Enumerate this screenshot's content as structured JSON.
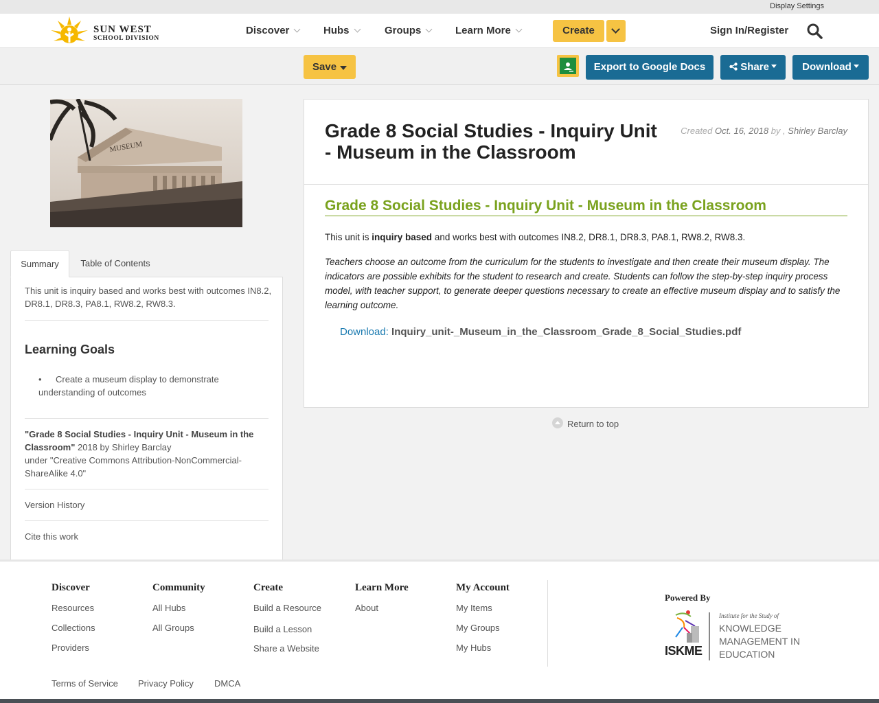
{
  "util": {
    "display_settings": "Display Settings"
  },
  "header": {
    "logo_line1": "SUN WEST",
    "logo_line2": "SCHOOL DIVISION",
    "nav": [
      "Discover",
      "Hubs",
      "Groups",
      "Learn More"
    ],
    "create": "Create",
    "signin": "Sign In/Register"
  },
  "toolbar": {
    "save": "Save",
    "export": "Export to Google Docs",
    "share": "Share",
    "download": "Download"
  },
  "colors": {
    "accent_yellow": "#f6c343",
    "button_blue": "#1a6b94",
    "heading_green": "#7aa21e",
    "link_blue": "#1a7ab0"
  },
  "cover": {
    "sign_text": "MUSEUM"
  },
  "tabs": [
    "Summary",
    "Table of Contents"
  ],
  "sidebar": {
    "summary": "This unit is inquiry based and works best with outcomes IN8.2, DR8.1, DR8.3, PA8.1, RW8.2, RW8.3.",
    "goals_heading": "Learning Goals",
    "goal_1": "Create a museum display to demonstrate understanding of outcomes",
    "license_title": "\"Grade 8 Social Studies - Inquiry Unit - Museum in the Classroom\"",
    "license_year_author": " 2018 by Shirley Barclay",
    "license_under": "under \"Creative Commons Attribution-NonCommercial-ShareAlike 4.0\"",
    "version_history": "Version History",
    "cite": "Cite this work"
  },
  "resource": {
    "title": "Grade 8 Social Studies - Inquiry Unit - Museum in the Classroom",
    "created_label": "Created",
    "created_date": "Oct. 16, 2018",
    "created_by": "by ,",
    "author": "Shirley Barclay",
    "heading": "Grade 8 Social Studies - Inquiry Unit - Museum in the Classroom",
    "intro_pre": "This unit is ",
    "intro_bold": "inquiry based",
    "intro_post": " and works best with outcomes IN8.2, DR8.1, DR8.3, PA8.1, RW8.2, RW8.3.",
    "description": "Teachers choose an outcome from the curriculum for the students to investigate and then create their museum display.  The indicators are possible exhibits for the student to research and create. Students can follow the step-by-step inquiry process model, with teacher support, to generate deeper questions necessary to create an effective museum display and to satisfy the learning outcome.",
    "download_label": "Download: ",
    "download_file": "Inquiry_unit-_Museum_in_the_Classroom_Grade_8_Social_Studies.pdf",
    "return_top": "Return to top"
  },
  "footer": {
    "columns": [
      {
        "heading": "Discover",
        "links": [
          "Resources",
          "Collections",
          "Providers"
        ]
      },
      {
        "heading": "Community",
        "links": [
          "All Hubs",
          "All Groups"
        ]
      },
      {
        "heading": "Create",
        "links": [
          "Build a Resource",
          "Build a Lesson",
          "Share a Website"
        ]
      },
      {
        "heading": "Learn More",
        "links": [
          "About"
        ]
      },
      {
        "heading": "My Account",
        "links": [
          "My Items",
          "My Groups",
          "My Hubs"
        ]
      }
    ],
    "powered_by": "Powered By",
    "iskme_tagline": "Institute for the Study of",
    "iskme_l1": "KNOWLEDGE",
    "iskme_l2": "MANAGEMENT IN",
    "iskme_l3": "EDUCATION",
    "iskme_mark": "ISKME",
    "bottom_links": [
      "Terms of Service",
      "Privacy Policy",
      "DMCA"
    ]
  }
}
